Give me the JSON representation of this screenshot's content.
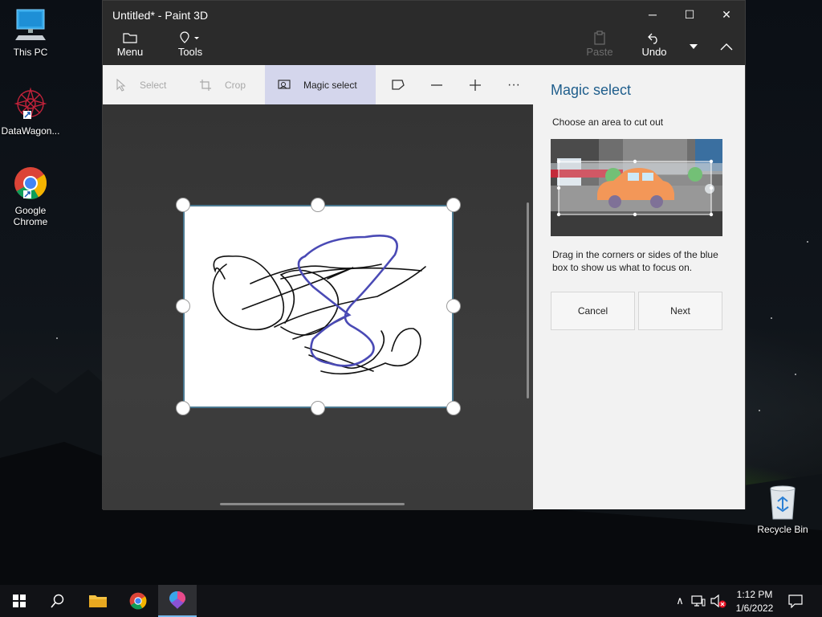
{
  "desktop": {
    "icons": [
      {
        "label": "This PC"
      },
      {
        "label": "DataWagon..."
      },
      {
        "label": "Google Chrome"
      },
      {
        "label": "Recycle Bin"
      }
    ]
  },
  "window": {
    "title": "Untitled* - Paint 3D",
    "controls": {
      "minimize": "─",
      "maximize": "☐",
      "close": "✕"
    }
  },
  "menubar": {
    "menu_label": "Menu",
    "tools_label": "Tools",
    "paste_label": "Paste",
    "undo_label": "Undo"
  },
  "toolbar": {
    "select_label": "Select",
    "crop_label": "Crop",
    "magic_select_label": "Magic select",
    "more_label": "···"
  },
  "panel": {
    "title": "Magic select",
    "subtitle": "Choose an area to cut out",
    "description": "Drag in the corners or sides of the blue box to show us what to focus on.",
    "cancel_label": "Cancel",
    "next_label": "Next"
  },
  "taskbar": {
    "time": "1:12 PM",
    "date": "1/6/2022",
    "tray_chevron": "∧"
  },
  "colors": {
    "accent_title": "#1f5e8c",
    "active_tool_bg": "#d4d6ec",
    "blue_stroke": "#4a4ab5",
    "paper_border": "#4a7890"
  }
}
